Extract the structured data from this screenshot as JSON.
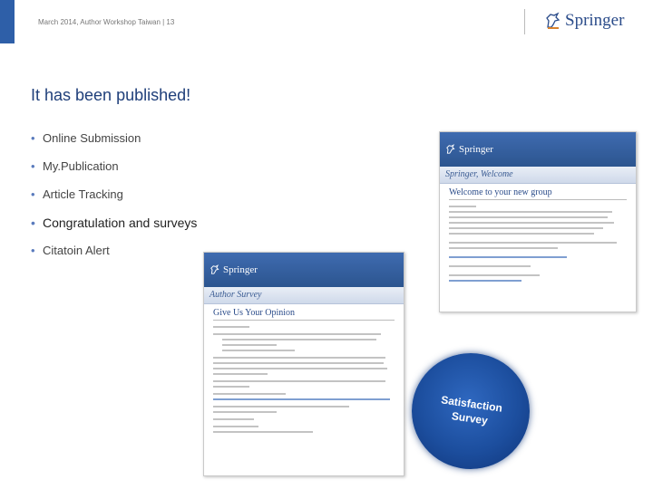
{
  "header": {
    "footer_text": "March 2014, Author Workshop Taiwan | 13",
    "logo_text": "Springer"
  },
  "slide": {
    "title": "It has been published!",
    "bullets": [
      {
        "label": "Online Submission"
      },
      {
        "label": "My.Publication"
      },
      {
        "label": "Article Tracking"
      },
      {
        "label": "Congratulation and surveys"
      },
      {
        "label": "Citatoin Alert"
      }
    ]
  },
  "welcome_email": {
    "brand": "Springer",
    "subtitle": "Springer, Welcome",
    "heading": "Welcome to your new group"
  },
  "survey_email": {
    "brand": "Springer",
    "subtitle": "Author Survey",
    "heading": "Give Us Your Opinion"
  },
  "badge": {
    "line1": "Satisfaction",
    "line2": "Survey"
  },
  "colors": {
    "accent": "#2e5fa8",
    "title": "#1f3f7a",
    "badge": "#1c4e9e"
  }
}
